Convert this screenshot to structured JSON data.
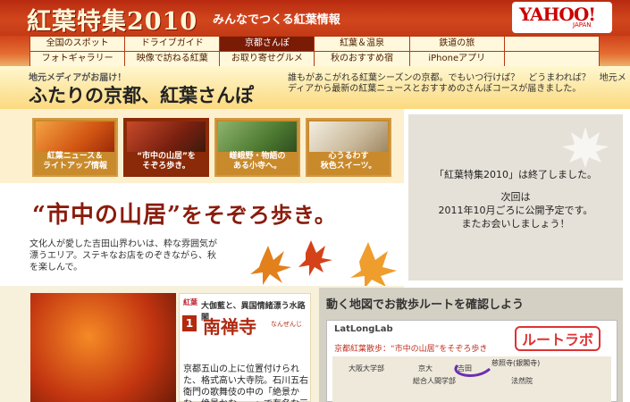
{
  "header": {
    "title": "紅葉特集2010",
    "subtitle": "みんなでつくる紅葉情報",
    "logo": "YAHOO!",
    "logo_sub": "JAPAN"
  },
  "nav": {
    "row1": [
      "全国のスポット",
      "ドライブガイド",
      "京都さんぽ",
      "紅葉＆温泉",
      "鉄道の旅"
    ],
    "row2": [
      "フォトギャラリー",
      "映像で訪ねる紅葉",
      "お取り寄せグルメ",
      "秋のおすすめ宿",
      "iPhoneアプリ"
    ],
    "active_index": 2
  },
  "banner": {
    "kicker": "地元メディアがお届け！",
    "headline": "ふたりの京都、紅葉さんぽ",
    "lead": "誰もがあこがれる紅葉シーズンの京都。でもいつ行けば？　どうまわれば？　地元メディアから最新の紅葉ニュースとおすすめのさんぽコースが届きました。"
  },
  "cards": [
    {
      "label1": "紅葉ニュース＆",
      "label2": "ライトアップ情報"
    },
    {
      "label1": "“市中の山居”を",
      "label2": "そぞろ歩き。"
    },
    {
      "label1": "嵯峨野・物語の",
      "label2": "ある小寺へ。"
    },
    {
      "label1": "心うるわす",
      "label2": "秋色スイーツ。"
    }
  ],
  "feature": {
    "headline_main": "“市中の山居”",
    "headline_tail": "をそぞろ歩き。",
    "description": "文化人が愛した吉田山界わいは、粋な雰囲気が漂うエリア。ステキなお店をのぞきながら、秋を楽しんで。"
  },
  "notice": {
    "line1": "「紅葉特集2010」は終了しました。",
    "line2": "次回は",
    "line3": "2011年10月ごろに公開予定です。",
    "line4": "またお会いしましょう！"
  },
  "spot": {
    "kana": "紅葉",
    "number": "1",
    "caption": "大伽藍と、異国情緒漂う水路閣",
    "name": "南禅寺",
    "ruby": "なんぜんじ",
    "body": "京都五山の上に位置付けられた、格式高い大寺院。石川五右衛門の歌舞伎の中の「絶景かな、絶景かな……」で有名な三門"
  },
  "mapbox": {
    "title": "動く地図でお散歩ルートを確認しよう",
    "lab": "LatLongLab",
    "route": "京都紅葉散歩：“市中の山居”をそぞろ歩き",
    "logo": "ルートラボ",
    "labels": [
      "大阪大学部",
      "京大",
      "総合人間学部",
      "吉田",
      "慈照寺(銀閣寺)",
      "法然院"
    ]
  }
}
